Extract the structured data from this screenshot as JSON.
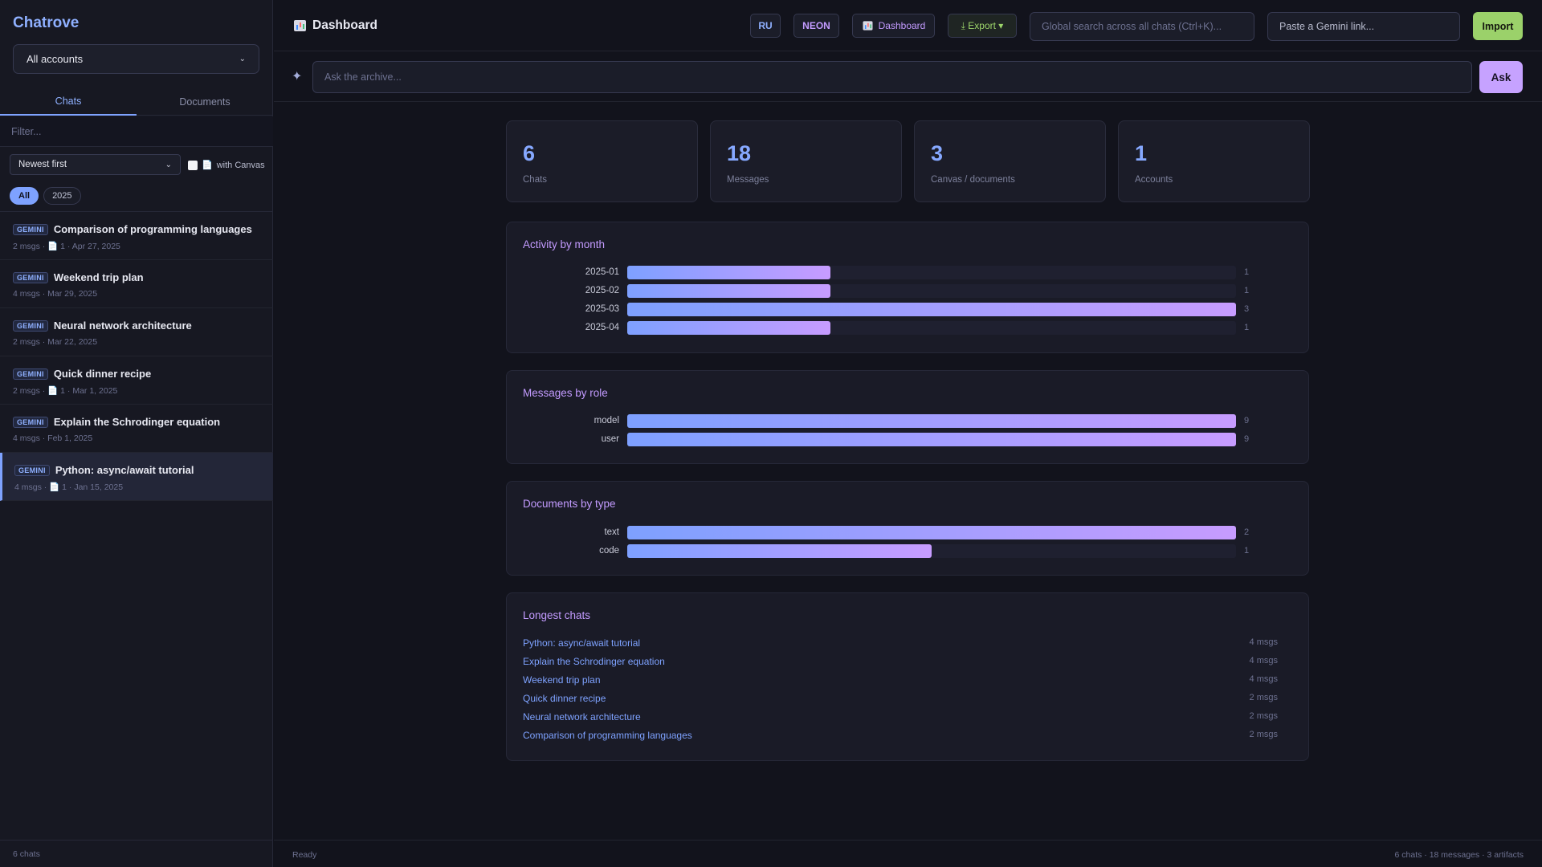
{
  "sidebar": {
    "brand": "Chatrove",
    "account_select": "All accounts",
    "tabs": [
      "Chats",
      "Documents"
    ],
    "filter_placeholder": "Filter...",
    "sort_select": "Newest first",
    "canvas_filter_label": "with Canvas",
    "year_chips": [
      "All",
      "2025"
    ],
    "chats": [
      {
        "badge": "GEMINI",
        "title": "Comparison of programming languages",
        "meta": "2 msgs · 📄 1 · Apr 27, 2025"
      },
      {
        "badge": "GEMINI",
        "title": "Weekend trip plan",
        "meta": "4 msgs · Mar 29, 2025"
      },
      {
        "badge": "GEMINI",
        "title": "Neural network architecture",
        "meta": "2 msgs · Mar 22, 2025"
      },
      {
        "badge": "GEMINI",
        "title": "Quick dinner recipe",
        "meta": "2 msgs · 📄 1 · Mar 1, 2025"
      },
      {
        "badge": "GEMINI",
        "title": "Explain the Schrodinger equation",
        "meta": "4 msgs · Feb 1, 2025"
      },
      {
        "badge": "GEMINI",
        "title": "Python: async/await tutorial",
        "meta": "4 msgs · 📄 1 · Jan 15, 2025",
        "selected": true
      }
    ],
    "footer": "6 chats"
  },
  "topbar": {
    "title": "Dashboard",
    "lang_button": "RU",
    "theme_button": "NEON",
    "dashboard_button": "Dashboard",
    "export_button": "⤓ Export ▾",
    "search_placeholder": "Global search across all chats (Ctrl+K)...",
    "gemini_link_placeholder": "Paste a Gemini link...",
    "import_button": "Import"
  },
  "askbar": {
    "placeholder": "Ask the archive...",
    "button": "Ask"
  },
  "stats": [
    {
      "value": "6",
      "label": "Chats"
    },
    {
      "value": "18",
      "label": "Messages"
    },
    {
      "value": "3",
      "label": "Canvas / documents"
    },
    {
      "value": "1",
      "label": "Accounts"
    }
  ],
  "panels": {
    "activity": {
      "title": "Activity by month",
      "rows": [
        {
          "label": "2025-01",
          "value": 1
        },
        {
          "label": "2025-02",
          "value": 1
        },
        {
          "label": "2025-03",
          "value": 3
        },
        {
          "label": "2025-04",
          "value": 1
        }
      ],
      "max": 3
    },
    "roles": {
      "title": "Messages by role",
      "rows": [
        {
          "label": "model",
          "value": 9
        },
        {
          "label": "user",
          "value": 9
        }
      ],
      "max": 9
    },
    "doctypes": {
      "title": "Documents by type",
      "rows": [
        {
          "label": "text",
          "value": 2
        },
        {
          "label": "code",
          "value": 1
        }
      ],
      "max": 2
    },
    "longest": {
      "title": "Longest chats",
      "rows": [
        {
          "title": "Python: async/await tutorial",
          "count": "4 msgs"
        },
        {
          "title": "Explain the Schrodinger equation",
          "count": "4 msgs"
        },
        {
          "title": "Weekend trip plan",
          "count": "4 msgs"
        },
        {
          "title": "Quick dinner recipe",
          "count": "2 msgs"
        },
        {
          "title": "Neural network architecture",
          "count": "2 msgs"
        },
        {
          "title": "Comparison of programming languages",
          "count": "2 msgs"
        }
      ]
    }
  },
  "statusbar": {
    "left": "Ready",
    "right": "6 chats · 18 messages · 3 artifacts"
  },
  "colors": {
    "accent_blue": "#7ea2ff",
    "accent_purple": "#c39bff",
    "import_green": "#9bd16a",
    "background": "#12131c"
  }
}
